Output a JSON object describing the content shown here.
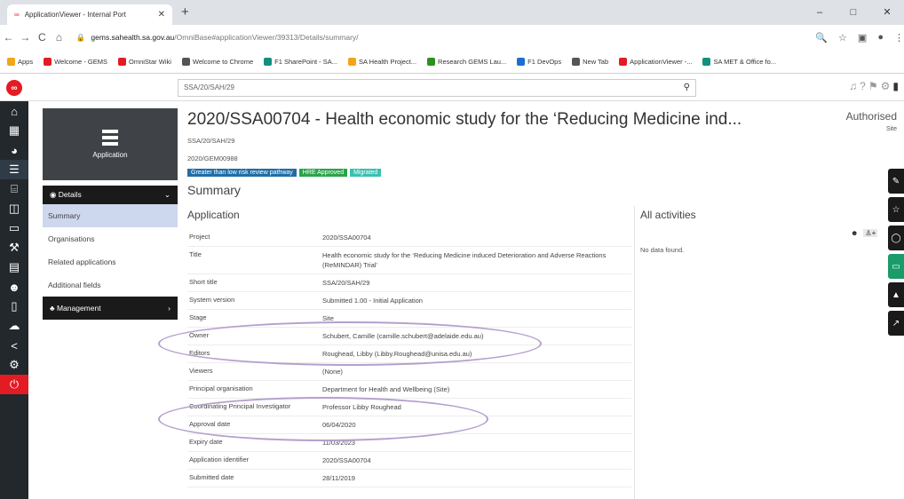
{
  "browser": {
    "tab_title": "ApplicationViewer - Internal Port",
    "url_host": "gems.sahealth.sa.gov.au",
    "url_path": "/OmniBase#applicationViewer/39313/Details/summary/",
    "bookmarks": [
      {
        "label": "Apps",
        "color": "#f2a516"
      },
      {
        "label": "Welcome - GEMS",
        "color": "#e31b23"
      },
      {
        "label": "OmniStar Wiki",
        "color": "#e31b23"
      },
      {
        "label": "Welcome to Chrome",
        "color": "#555555"
      },
      {
        "label": "F1 SharePoint - SA...",
        "color": "#138f80"
      },
      {
        "label": "SA Health Project...",
        "color": "#f2a516"
      },
      {
        "label": "Research GEMS Lau...",
        "color": "#2d8f1f"
      },
      {
        "label": "F1 DevOps",
        "color": "#1a6fd1"
      },
      {
        "label": "New Tab",
        "color": "#555555"
      },
      {
        "label": "ApplicationViewer -...",
        "color": "#e31b23"
      },
      {
        "label": "SA MET & Office fo...",
        "color": "#138f80"
      }
    ]
  },
  "header": {
    "search_value": "SSA/20/SAH/29"
  },
  "left": {
    "app_card_label": "Application",
    "details_label": "Details",
    "items": [
      "Summary",
      "Organisations",
      "Related applications",
      "Additional fields"
    ],
    "management_label": "Management"
  },
  "main": {
    "title": "2020/SSA00704 - Health economic study for the ‘Reducing Medicine ind...",
    "status": "Authorised",
    "status_sub": "Site",
    "subtitle1": "SSA/20/SAH/29",
    "subtitle2": "2020/GEM00988",
    "badges": [
      {
        "label": "Greater than low risk review pathway",
        "color": "#1f6ea8"
      },
      {
        "label": "HRE Approved",
        "color": "#2aa44a"
      },
      {
        "label": "Migrated",
        "color": "#39c0b0"
      }
    ],
    "section": "Summary",
    "application_heading": "Application",
    "activities_heading": "All activities",
    "activities_empty": "No data found.",
    "fields": [
      {
        "k": "Project",
        "v": "2020/SSA00704"
      },
      {
        "k": "Title",
        "v": "Health economic study for the ‘Reducing Medicine induced Deterioration and Adverse Reactions (ReMINDAR) Trial’"
      },
      {
        "k": "Short title",
        "v": "SSA/20/SAH/29"
      },
      {
        "k": "System version",
        "v": "Submitted 1.00 - Initial Application"
      },
      {
        "k": "Stage",
        "v": "Site"
      },
      {
        "k": "Owner",
        "v": "Schubert, Camille (camille.schubert@adelaide.edu.au)"
      },
      {
        "k": "Editors",
        "v": "Roughead, Libby (Libby.Roughead@unisa.edu.au)"
      },
      {
        "k": "Viewers",
        "v": "(None)"
      },
      {
        "k": "Principal organisation",
        "v": "Department for Health and Wellbeing (Site)"
      },
      {
        "k": "Coordinating Principal Investigator",
        "v": "Professor Libby Roughead"
      },
      {
        "k": "Approval date",
        "v": "06/04/2020"
      },
      {
        "k": "Expiry date",
        "v": "11/03/2023"
      },
      {
        "k": "Application identifier",
        "v": "2020/SSA00704"
      },
      {
        "k": "Submitted date",
        "v": "28/11/2019"
      }
    ]
  }
}
